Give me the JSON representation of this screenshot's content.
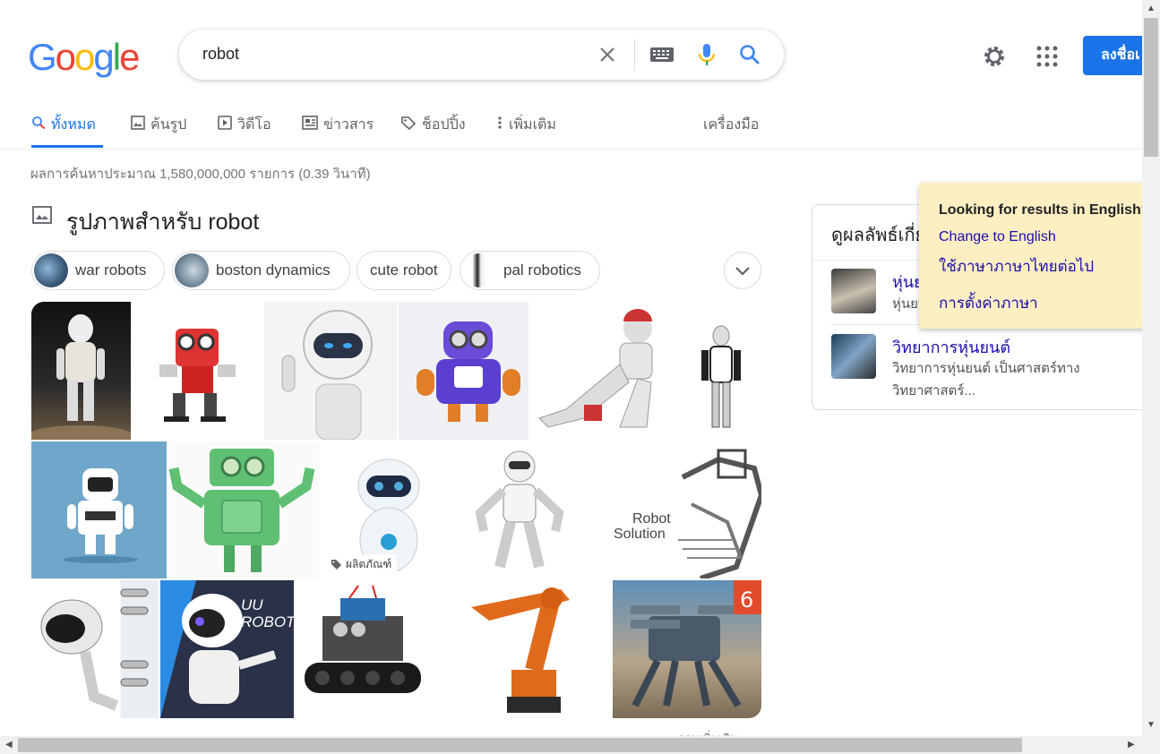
{
  "header": {
    "logo": [
      "G",
      "o",
      "o",
      "g",
      "l",
      "e"
    ],
    "logo_colors": [
      "#4285f4",
      "#ea4335",
      "#fbbc05",
      "#4285f4",
      "#34a853",
      "#ea4335"
    ],
    "search_value": "robot",
    "signin_label": "ลงชื่อเ"
  },
  "tabs": [
    {
      "label": "ทั้งหมด",
      "icon": "search-icon",
      "active": true
    },
    {
      "label": "ค้นรูป",
      "icon": "image-icon"
    },
    {
      "label": "วิดีโอ",
      "icon": "video-icon"
    },
    {
      "label": "ข่าวสาร",
      "icon": "news-icon"
    },
    {
      "label": "ช็อปปิ้ง",
      "icon": "tag-icon"
    },
    {
      "label": "เพิ่มเติม",
      "icon": "more-vert-icon"
    },
    {
      "label": "เครื่องมือ"
    }
  ],
  "stats": "ผลการค้นหาประมาณ 1,580,000,000 รายการ (0.39 วินาที)",
  "images": {
    "heading": "รูปภาพสำหรับ robot",
    "chips": [
      "war robots",
      "boston dynamics",
      "cute robot",
      "pal robotics"
    ],
    "product_badge": "ผลิตภัณฑ์",
    "robot_solution_text": [
      "Robot",
      "Solution"
    ],
    "uu_text": [
      "UU",
      "ROBOT"
    ],
    "more_text": "ภาพเพิ่มเติม"
  },
  "knowledge": {
    "title": "ดูผลลัพธ์เกี่ยวกับ",
    "item1_title": "หุ่นยนต์",
    "item1_sub": "หุ่นยนต์",
    "item2_title": "วิทยาการหุ่นยนต์",
    "item2_sub": "วิทยาการหุ่นยนต์ เป็นศาสตร์ทางวิทยาศาสตร์..."
  },
  "lang_popup": {
    "title": "Looking for results in English?",
    "change": "Change to English",
    "keep": "ใช้ภาษาภาษาไทยต่อไป",
    "settings": "การตั้งค่าภาษา"
  },
  "colors": {
    "accent": "#1a73e8",
    "link": "#1a0dab",
    "popup_bg": "#feefc3"
  }
}
